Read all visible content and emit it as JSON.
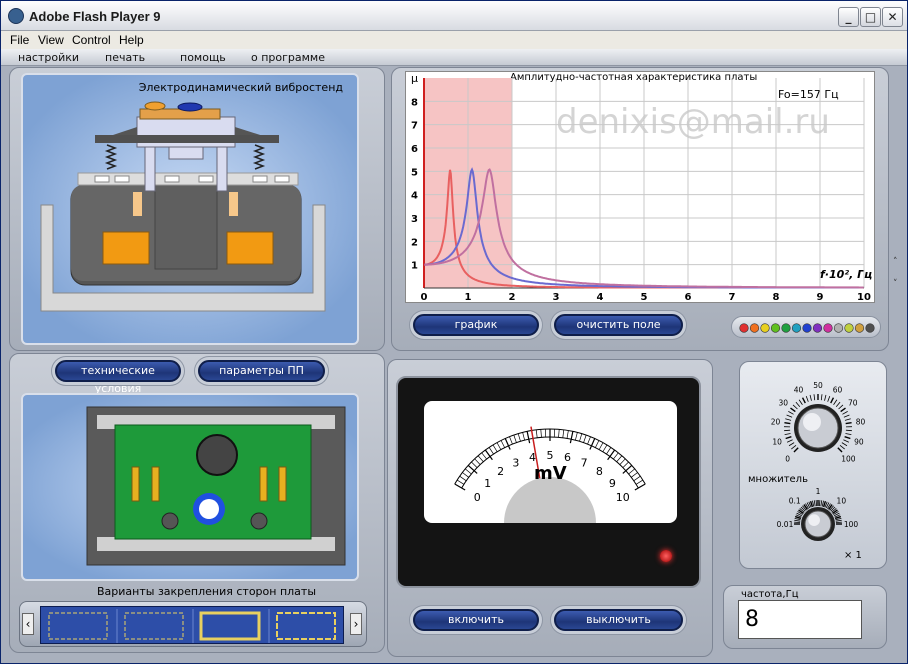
{
  "window": {
    "title": "Adobe Flash Player 9",
    "min": "_",
    "max": "□",
    "close": "✕"
  },
  "menu": {
    "file": "File",
    "view": "View",
    "control": "Control",
    "help": "Help"
  },
  "app_tabs": [
    "настройки",
    "печать",
    "помощь",
    "о программе"
  ],
  "vibro_panel": {
    "title": "Электродинамический вибростенд"
  },
  "chart_panel": {
    "title": "Амплитудно-частотная характеристика платы",
    "fo_label": "Fo=157 Гц",
    "watermark": "denixis@mail.ru",
    "y_axis_label": "μ",
    "x_axis_label": "f·10², Гц",
    "graph_button": "график",
    "clear_button": "очистить поле",
    "palette_colors": [
      "#e03030",
      "#f07020",
      "#e8d020",
      "#60c020",
      "#20a040",
      "#20a0c0",
      "#2040d0",
      "#8030c0",
      "#d030a0",
      "#b0b0b0",
      "#c0d040",
      "#d0a040",
      "#505050"
    ]
  },
  "chart_data": {
    "type": "line",
    "xlabel": "f·10², Гц",
    "ylabel": "μ",
    "xlim": [
      0,
      10
    ],
    "ylim": [
      0,
      9
    ],
    "x_ticks": [
      0,
      1,
      2,
      3,
      4,
      5,
      6,
      7,
      8,
      9,
      10
    ],
    "y_ticks": [
      1,
      2,
      3,
      4,
      5,
      6,
      7,
      8
    ],
    "highlight_range": [
      0,
      2
    ],
    "series": [
      {
        "color": "#e86060",
        "peak_x": 0.6,
        "peak_y": 5.2
      },
      {
        "color": "#6a6ad0",
        "peak_x": 1.1,
        "peak_y": 5.2
      },
      {
        "color": "#c070a0",
        "peak_x": 1.5,
        "peak_y": 5.2
      }
    ]
  },
  "board_panel": {
    "tech_button": "технические условия",
    "params_button": "параметры ПП",
    "variants_label": "Варианты закрепления сторон платы",
    "left_arrow": "‹",
    "right_arrow": "›"
  },
  "meter": {
    "unit": "mV",
    "scale": [
      "0",
      "1",
      "2",
      "3",
      "4",
      "5",
      "6",
      "7",
      "8",
      "9",
      "10"
    ],
    "value": 4.2,
    "on_button": "включить",
    "off_button": "выключить"
  },
  "knobs": {
    "top_scale": [
      "0",
      "10",
      "20",
      "30",
      "40",
      "50",
      "60",
      "70",
      "80",
      "90",
      "100"
    ],
    "multiplier_label": "множитель",
    "mult_scale": [
      "0.01",
      "0.1",
      "1",
      "10",
      "100"
    ],
    "mult_value": "× 1"
  },
  "frequency": {
    "label": "частота,Гц",
    "value": "8"
  },
  "scroll": {
    "up": "˄",
    "down": "˅"
  }
}
